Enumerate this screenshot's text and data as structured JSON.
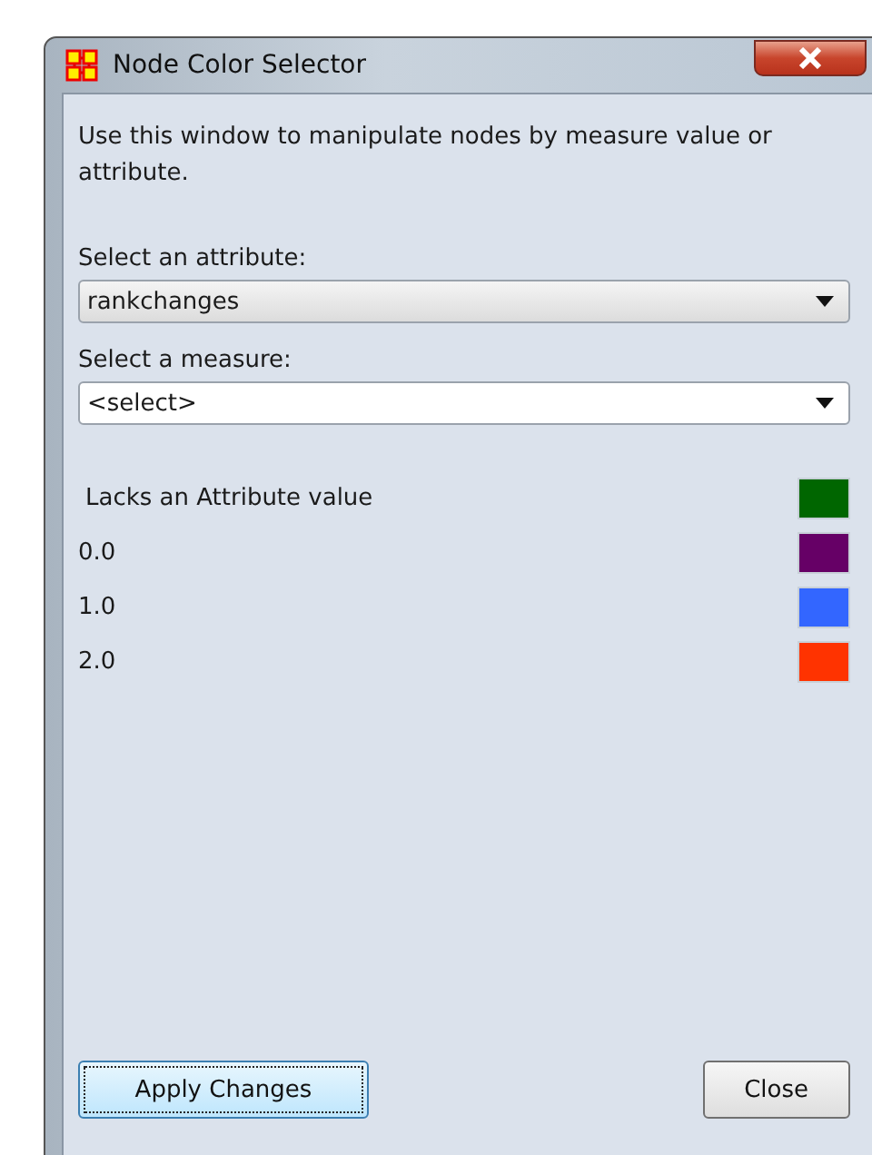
{
  "window": {
    "title": "Node Color Selector"
  },
  "description": "Use this window to manipulate nodes by measure value or attribute.",
  "attribute": {
    "label": "Select an attribute:",
    "value": "rankchanges"
  },
  "measure": {
    "label": "Select a measure:",
    "value": "<select>"
  },
  "legend": [
    {
      "label": "Lacks an Attribute value",
      "color": "#006600"
    },
    {
      "label": "0.0",
      "color": "#660066"
    },
    {
      "label": "1.0",
      "color": "#3366ff"
    },
    {
      "label": "2.0",
      "color": "#ff3300"
    }
  ],
  "buttons": [
    {
      "label": "Apply Changes",
      "focused": true
    },
    {
      "label": "Close",
      "focused": false
    }
  ]
}
